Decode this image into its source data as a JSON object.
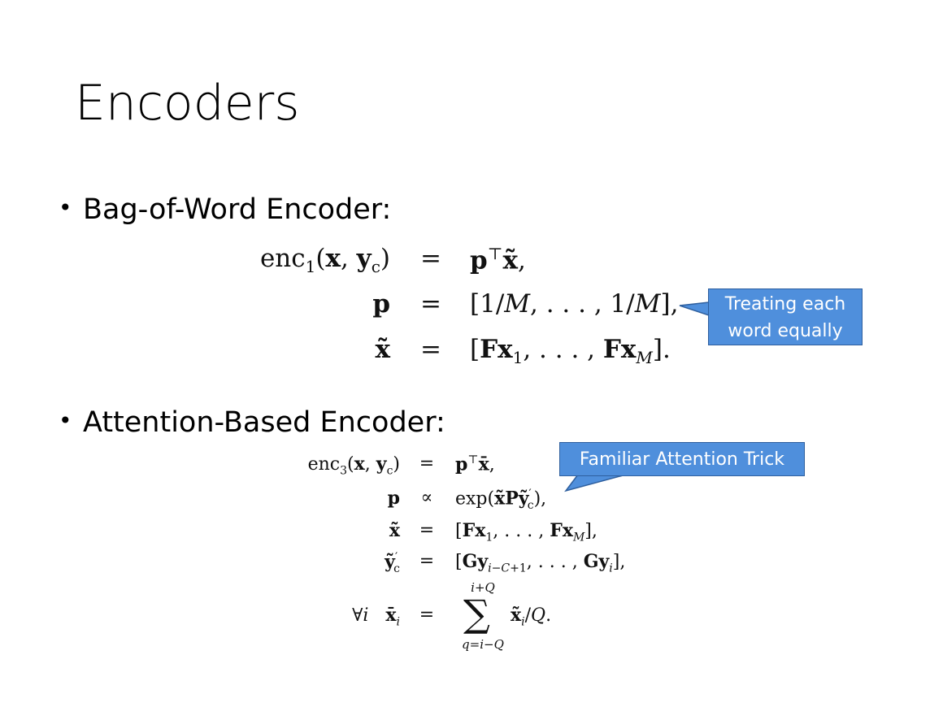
{
  "slide": {
    "title": "Encoders",
    "bullets": [
      {
        "marker": "•",
        "text": "Bag-of-Word Encoder:"
      },
      {
        "marker": "•",
        "text": "Attention-Based Encoder:"
      }
    ],
    "callouts": [
      {
        "line1": "Treating each",
        "line2": "word equally"
      },
      {
        "text": "Familiar Attention Trick"
      }
    ],
    "colors": {
      "callout_fill": "#4f8fdc",
      "callout_border": "#2e5f9e",
      "text": "#000000"
    }
  }
}
